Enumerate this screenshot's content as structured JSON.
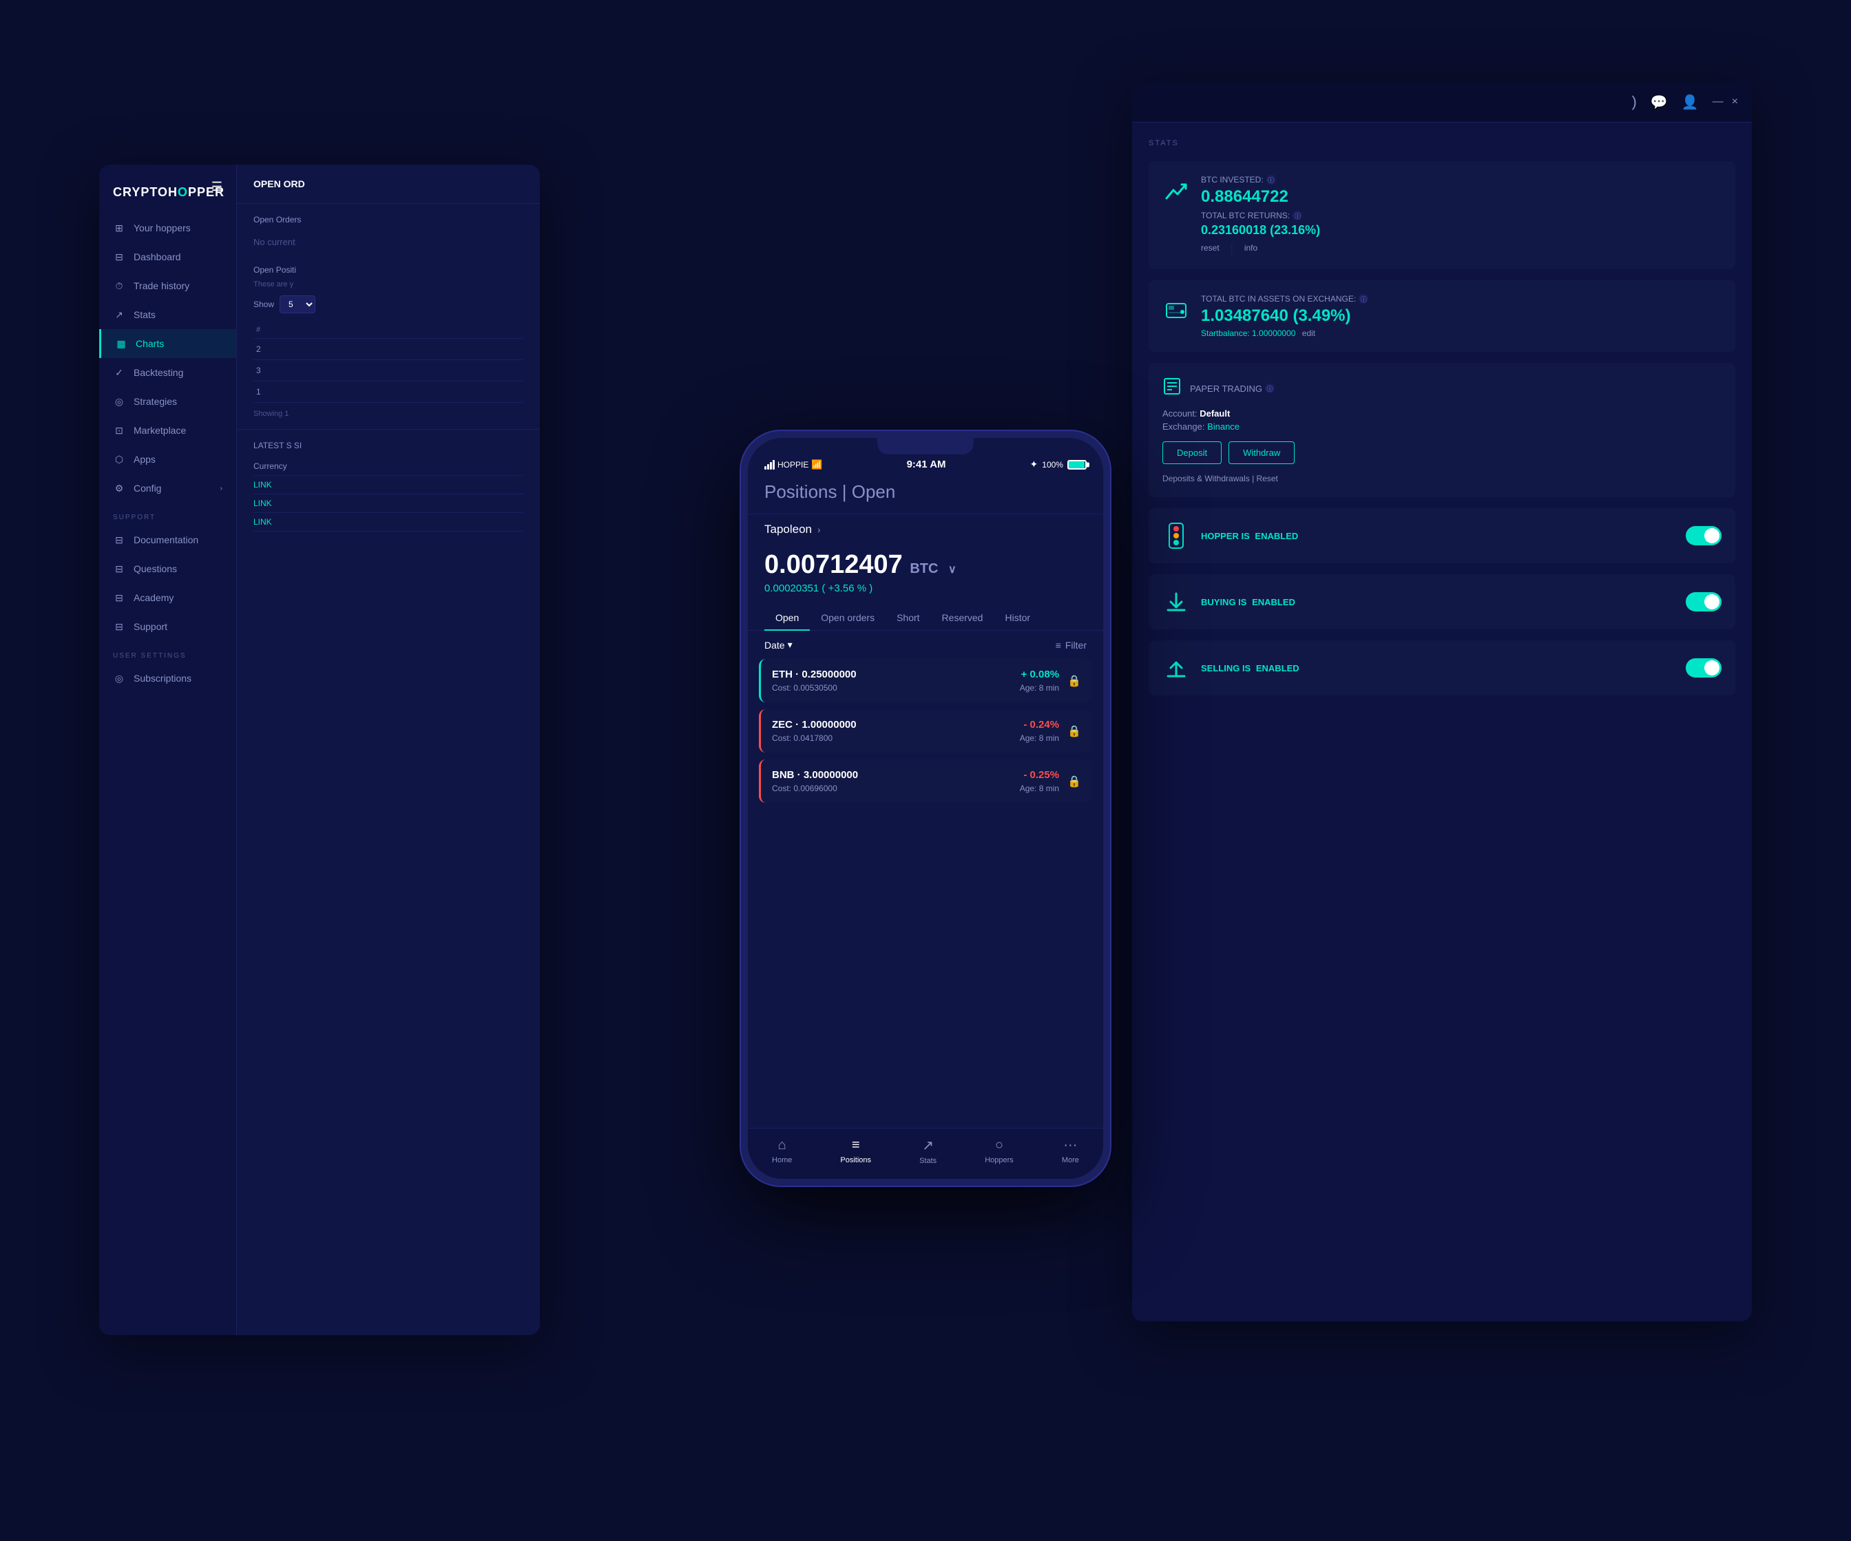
{
  "app": {
    "name": "CRYPTOHOPPER",
    "name_accent": "O"
  },
  "sidebar": {
    "items": [
      {
        "id": "your-hoppers",
        "label": "Your hoppers",
        "icon": "⊞"
      },
      {
        "id": "dashboard",
        "label": "Dashboard",
        "icon": "⊟"
      },
      {
        "id": "trade-history",
        "label": "Trade history",
        "icon": "⏱"
      },
      {
        "id": "stats",
        "label": "Stats",
        "icon": "↗"
      },
      {
        "id": "charts",
        "label": "Charts",
        "icon": "▦",
        "active": true
      },
      {
        "id": "backtesting",
        "label": "Backtesting",
        "icon": "✓"
      },
      {
        "id": "strategies",
        "label": "Strategies",
        "icon": "◎"
      },
      {
        "id": "marketplace",
        "label": "Marketplace",
        "icon": "⊡"
      },
      {
        "id": "apps",
        "label": "Apps",
        "icon": "⬡"
      },
      {
        "id": "config",
        "label": "Config",
        "icon": "⚙",
        "has_arrow": true
      }
    ],
    "support_section": "SUPPORT",
    "support_items": [
      {
        "id": "documentation",
        "label": "Documentation",
        "icon": "⊟"
      },
      {
        "id": "questions",
        "label": "Questions",
        "icon": "⊟"
      },
      {
        "id": "academy",
        "label": "Academy",
        "icon": "⊟"
      },
      {
        "id": "support",
        "label": "Support",
        "icon": "⊟"
      }
    ],
    "user_settings_section": "USER SETTINGS",
    "user_items": [
      {
        "id": "subscriptions",
        "label": "Subscriptions",
        "icon": "◎"
      }
    ]
  },
  "main_content": {
    "title": "OPEN ORD",
    "no_current": "No current",
    "open_positions_title": "Open Positi",
    "table_note": "These are y",
    "show_label": "Show",
    "showing_label": "Showing 1",
    "latest_signals": {
      "title": "LATEST S SI",
      "currency_label": "Currency",
      "links": [
        "LINK",
        "LINK",
        "LINK"
      ]
    },
    "table_rows": [
      {
        "num": "2",
        "value": ""
      },
      {
        "num": "3",
        "value": ""
      },
      {
        "num": "1",
        "value": ""
      }
    ]
  },
  "stats_panel": {
    "title": "STATS",
    "window_controls": {
      "minimize": "—",
      "close": "×"
    },
    "header_icons": {
      "crescent": ")",
      "chat": "💬",
      "user": "👤"
    },
    "btc_invested": {
      "label": "BTC INVESTED:",
      "value": "0.88644722",
      "info_icon": "ⓘ"
    },
    "total_btc_returns": {
      "label": "TOTAL BTC RETURNS:",
      "value": "0.23160018 (23.16%)",
      "info_icon": "ⓘ"
    },
    "reset_link": "reset",
    "info_link": "info",
    "total_btc_assets": {
      "label": "TOTAL BTC IN ASSETS ON EXCHANGE:",
      "value": "1.03487640 (3.49%)",
      "info_icon": "ⓘ",
      "start_balance": "Startbalance: 1.00000000",
      "edit_link": "edit"
    },
    "paper_trading": {
      "label": "PAPER TRADING",
      "info_icon": "ⓘ",
      "account_label": "Account:",
      "account_value": "Default",
      "exchange_label": "Exchange:",
      "exchange_value": "Binance",
      "deposit_btn": "Deposit",
      "withdraw_btn": "Withdraw",
      "footer_link1": "Deposits & Withdrawals",
      "footer_link2": "Reset"
    },
    "hopper_enabled": {
      "label": "HOPPER IS",
      "status": "ENABLED",
      "enabled": true
    },
    "buying_enabled": {
      "label": "BUYING IS",
      "status": "ENABLED",
      "enabled": true
    },
    "selling_enabled": {
      "label": "SELLING IS",
      "status": "ENABLED",
      "enabled": true
    }
  },
  "phone": {
    "carrier": "HOPPIE",
    "time": "9:41 AM",
    "battery_pct": "100%",
    "bluetooth": "✦",
    "title": "Positions",
    "title_suffix": "Open",
    "hopper_name": "Tapoleon",
    "balance": {
      "amount": "0.00712407",
      "currency": "BTC",
      "change_raw": "0.00020351",
      "change_pct": "+3.56 %"
    },
    "tabs": [
      {
        "id": "open",
        "label": "Open",
        "active": true
      },
      {
        "id": "open-orders",
        "label": "Open orders",
        "active": false
      },
      {
        "id": "short",
        "label": "Short",
        "active": false
      },
      {
        "id": "reserved",
        "label": "Reserved",
        "active": false
      },
      {
        "id": "history",
        "label": "Histor",
        "active": false
      }
    ],
    "filter": {
      "date_label": "Date",
      "filter_label": "Filter"
    },
    "positions": [
      {
        "coin": "ETH",
        "amount": "0.25000000",
        "cost": "0.00530500",
        "pct": "+ 0.08%",
        "age": "Age: 8 min",
        "positive": true
      },
      {
        "coin": "ZEC",
        "amount": "1.00000000",
        "cost": "0.0417800",
        "pct": "- 0.24%",
        "age": "Age: 8 min",
        "positive": false
      },
      {
        "coin": "BNB",
        "amount": "3.00000000",
        "cost": "0.00696000",
        "pct": "- 0.25%",
        "age": "Age: 8 min",
        "positive": false
      }
    ],
    "bottom_nav": [
      {
        "id": "home",
        "label": "Home",
        "icon": "⌂",
        "active": false
      },
      {
        "id": "positions",
        "label": "Positions",
        "icon": "≡",
        "active": true
      },
      {
        "id": "stats",
        "label": "Stats",
        "icon": "↗",
        "active": false
      },
      {
        "id": "hoppers",
        "label": "Hoppers",
        "icon": "○",
        "active": false
      },
      {
        "id": "more",
        "label": "More",
        "icon": "···",
        "active": false
      }
    ]
  },
  "colors": {
    "accent": "#00e5c8",
    "bg_dark": "#0a0e2e",
    "bg_panel": "#0d1240",
    "bg_card": "#111845",
    "text_muted": "#8892c8",
    "text_dim": "#4a5490",
    "negative": "#ff4d4d"
  }
}
